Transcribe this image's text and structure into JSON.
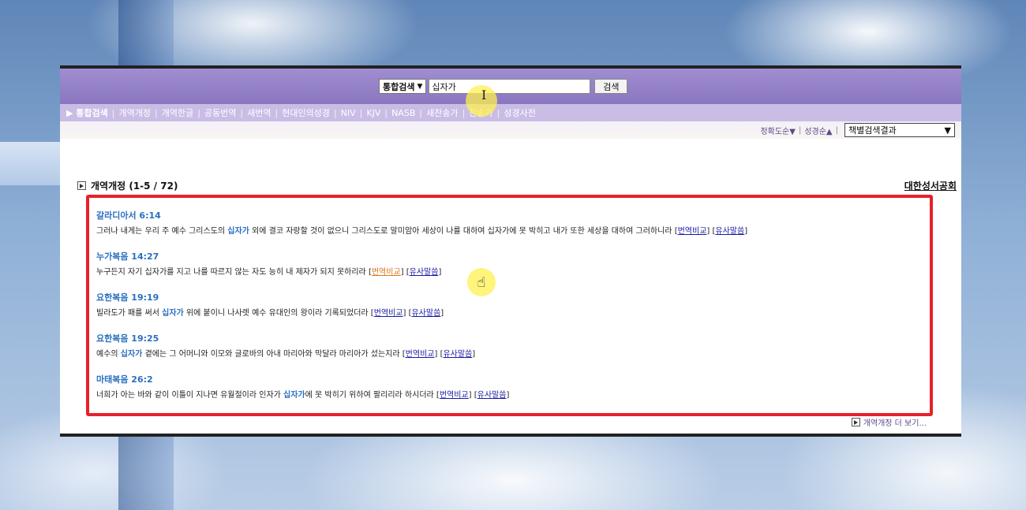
{
  "search": {
    "scope": "통합검색",
    "query": "십자가",
    "button": "검색"
  },
  "nav": [
    {
      "label": "▶ 통합검색",
      "active": true
    },
    {
      "label": "개역개정"
    },
    {
      "label": "개역한글"
    },
    {
      "label": "공동번역"
    },
    {
      "label": "새번역"
    },
    {
      "label": "현대인의성경"
    },
    {
      "label": "NIV"
    },
    {
      "label": "KJV"
    },
    {
      "label": "NASB"
    },
    {
      "label": "새찬송가"
    },
    {
      "label": "찬송가"
    },
    {
      "label": "성경사전"
    }
  ],
  "sort": {
    "accuracy": "정확도순▼",
    "bible_order": "성경순▲",
    "view_select": "책별검색결과"
  },
  "section": {
    "title": "개역개정 (1-5 / 72)",
    "publisher": "대한성서공회",
    "more": "개역개정 더 보기..."
  },
  "results": [
    {
      "ref": "갈라디아서 6:14",
      "pre": "그러나 내게는 우리 주 예수 그리스도의 ",
      "kw": "십자가",
      "post": " 외에 결코 자랑할 것이 없으니 그리스도로 말미암아 세상이 나를 대하여 십자가에 못 박히고 내가 또한 세상을 대하여 그러하니라 ",
      "compare": "번역비교",
      "similar": "유사말씀"
    },
    {
      "ref": "누가복음 14:27",
      "pre": "누구든지 자기 십자가를 지고 나를 따르지 않는 자도 능히 내 제자가 되지 못하리라 ",
      "kw": "",
      "post": "",
      "compare": "번역비교",
      "similar": "유사말씀"
    },
    {
      "ref": "요한복음 19:19",
      "pre": "빌라도가 패를 써서 ",
      "kw": "십자가",
      "post": " 위에 붙이니 나사렛 예수 유대인의 왕이라 기록되었더라 ",
      "compare": "번역비교",
      "similar": "유사말씀"
    },
    {
      "ref": "요한복음 19:25",
      "pre": "예수의 ",
      "kw": "십자가",
      "post": " 곁에는 그 어머니와 이모와 글로바의 아내 마리아와 막달라 마리아가 섰는지라 ",
      "compare": "번역비교",
      "similar": "유사말씀"
    },
    {
      "ref": "마태복음 26:2",
      "pre": "너희가 아는 바와 같이 이틀이 지나면 유월절이라 인자가 ",
      "kw": "십자가",
      "post": "에 못 박히기 위하여 팔리리라 하시더라 ",
      "compare": "번역비교",
      "similar": "유사말씀"
    }
  ]
}
